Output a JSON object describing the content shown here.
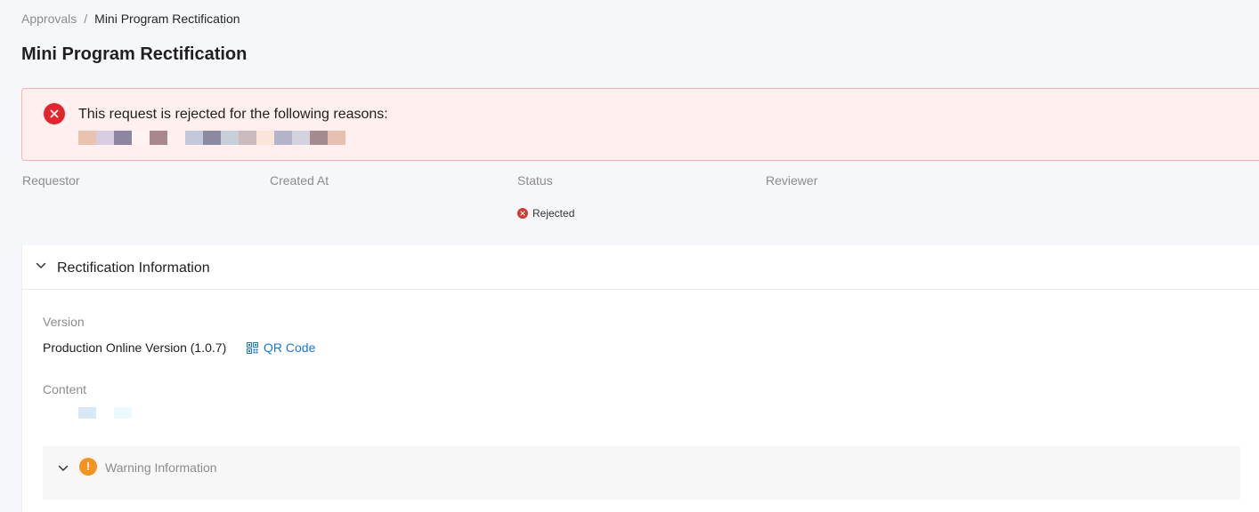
{
  "breadcrumb": {
    "parent": "Approvals",
    "separator": "/",
    "current": "Mini Program Rectification"
  },
  "page_title": "Mini Program Rectification",
  "alert": {
    "type": "error",
    "icon": "close-circle-icon",
    "message": "This request is rejected for the following reasons:"
  },
  "meta": {
    "requestor_label": "Requestor",
    "created_at_label": "Created At",
    "status_label": "Status",
    "reviewer_label": "Reviewer",
    "status_value": "Rejected"
  },
  "rectification": {
    "title": "Rectification Information",
    "version_label": "Version",
    "version_value": "Production Online Version (1.0.7)",
    "qr_code_label": "QR Code",
    "content_label": "Content",
    "warning_title": "Warning Information"
  },
  "colors": {
    "error": "#e5252b",
    "warning": "#f7921e",
    "link": "#1677d9",
    "background": "#f5f7fb"
  }
}
